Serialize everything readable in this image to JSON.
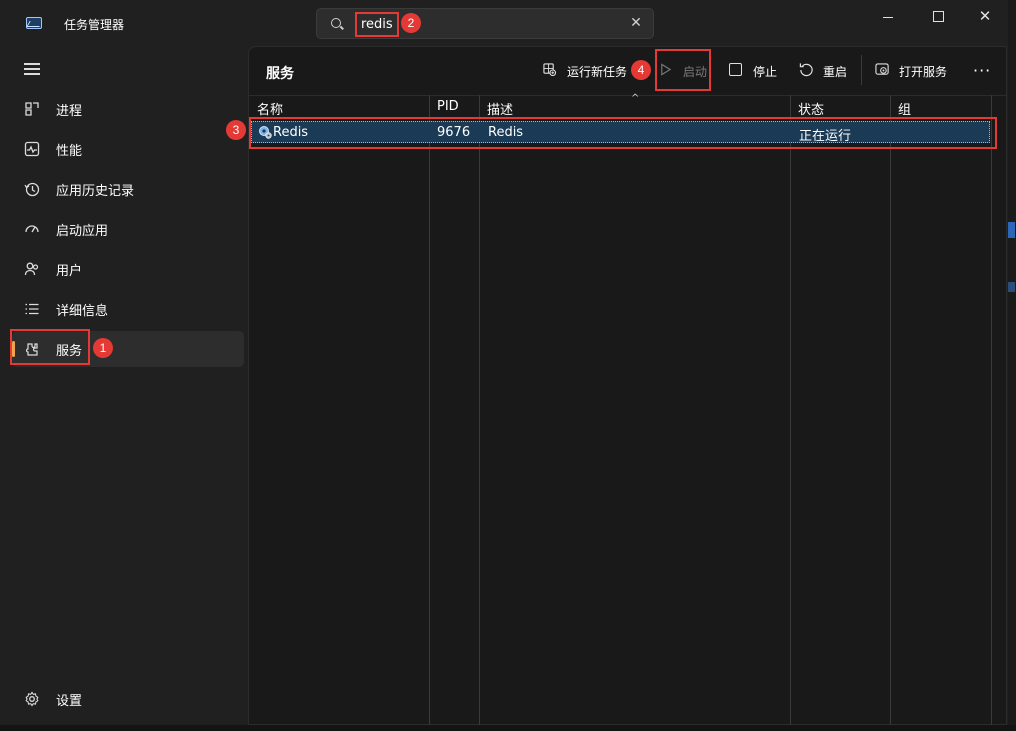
{
  "window": {
    "title": "任务管理器"
  },
  "search": {
    "value": "redis",
    "clear": "✕"
  },
  "sidebar": {
    "items": [
      {
        "label": "进程"
      },
      {
        "label": "性能"
      },
      {
        "label": "应用历史记录"
      },
      {
        "label": "启动应用"
      },
      {
        "label": "用户"
      },
      {
        "label": "详细信息"
      },
      {
        "label": "服务"
      }
    ],
    "settings": "设置"
  },
  "toolbar": {
    "title": "服务",
    "run_task": "运行新任务",
    "start": "启动",
    "stop": "停止",
    "restart": "重启",
    "open_services": "打开服务",
    "more": "···"
  },
  "table": {
    "columns": [
      "名称",
      "PID",
      "描述",
      "状态",
      "组"
    ],
    "rows": [
      {
        "name": "Redis",
        "pid": "9676",
        "description": "Redis",
        "status": "正在运行",
        "group": ""
      }
    ]
  },
  "annotations": [
    "1",
    "2",
    "3",
    "4"
  ],
  "colors": {
    "accent": "#f0a44a",
    "highlight": "#e53935",
    "selected_row": "#1a3a55"
  },
  "icons": [
    "app-icon",
    "search-icon",
    "close-icon",
    "hamburger-icon",
    "processes-icon",
    "performance-icon",
    "history-icon",
    "startup-icon",
    "users-icon",
    "details-icon",
    "services-icon",
    "settings-icon",
    "run-task-icon",
    "play-icon",
    "stop-icon",
    "restart-icon",
    "open-services-icon",
    "more-icon",
    "gear-icon"
  ]
}
